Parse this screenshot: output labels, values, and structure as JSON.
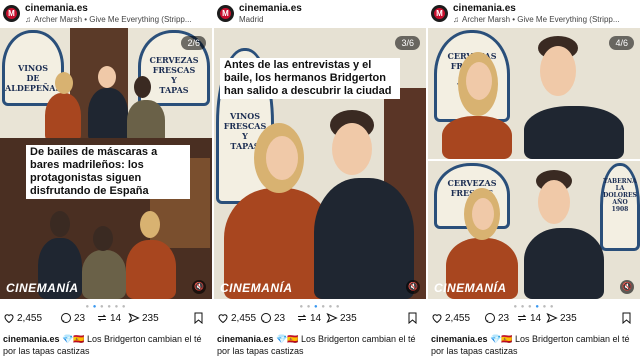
{
  "posts": [
    {
      "username": "cinemania.es",
      "subline": "Archer Marsh • Give Me Everything (Stripp...",
      "subline_icon": "music-note-icon",
      "counter": "2/6",
      "overlay_caption": "De bailes de máscaras a bares madrileños: los protagonistas siguen disfrutando de España",
      "brand": "CINEMANÍA",
      "tile_left": [
        "VINOS",
        "DE",
        "ALDEPEÑAS"
      ],
      "tile_right": [
        "CERVEZAS",
        "FRESCAS",
        "Y",
        "TAPAS"
      ],
      "likes": "2,455",
      "comments": "23",
      "reposts": "14",
      "shares": "235",
      "caption_user": "cinemania.es",
      "caption_emoji": "💎🇪🇸",
      "caption_text": "Los Bridgerton cambian el té por las tapas castizas"
    },
    {
      "username": "cinemania.es",
      "subline": "Madrid",
      "counter": "3/6",
      "overlay_caption": "Antes de las entrevistas y el baile, los hermanos Bridgerton han salido a descubrir la ciudad",
      "brand": "CINEMANÍA",
      "tile_left": [
        "VINOS",
        "FRESCAS",
        "Y",
        "TAPAS"
      ],
      "likes": "2,455",
      "comments": "23",
      "reposts": "14",
      "shares": "235",
      "caption_user": "cinemania.es",
      "caption_emoji": "💎🇪🇸",
      "caption_text": "Los Bridgerton cambian el té por las tapas castizas"
    },
    {
      "username": "cinemania.es",
      "subline": "Archer Marsh • Give Me Everything (Stripp...",
      "subline_icon": "music-note-icon",
      "counter": "4/6",
      "brand": "CINEMANÍA",
      "tile_top": [
        "CERVEZAS",
        "FRESCAS",
        "Y",
        "TAPAS"
      ],
      "tile_bottom": [
        "CERVEZAS",
        "FRESCAS"
      ],
      "tile_right_bottom": [
        "TABERNA",
        "LA",
        "DOLORES",
        "AÑO 1908"
      ],
      "likes": "2,455",
      "comments": "23",
      "reposts": "14",
      "shares": "235",
      "caption_user": "cinemania.es",
      "caption_emoji": "💎🇪🇸",
      "caption_text": "Los Bridgerton cambian el té por las tapas castizas"
    }
  ]
}
